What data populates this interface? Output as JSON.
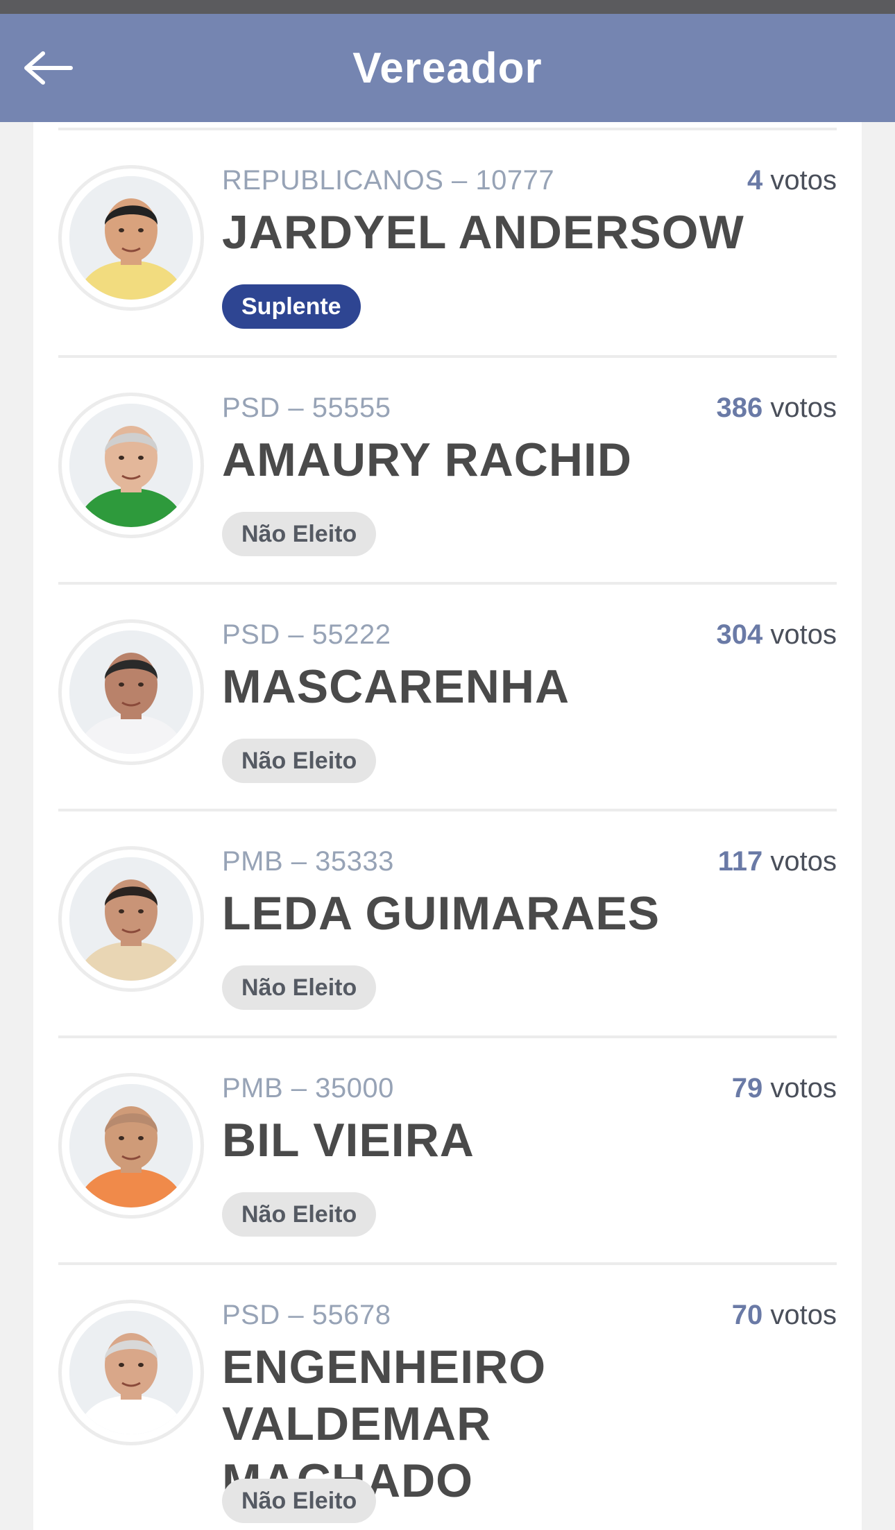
{
  "header": {
    "title": "Vereador",
    "back_icon": "arrow-left-icon"
  },
  "candidates": [
    {
      "party": "REPUBLICANOS – 10777",
      "votes_num": "4",
      "votes_unit": "votos",
      "name": "JARDYEL ANDERSOW",
      "status": "Suplente",
      "status_type": "suplente",
      "shirt_color": "#f2dc7f",
      "hair_color": "#222222",
      "skin_color": "#d9a27d"
    },
    {
      "party": "PSD – 55555",
      "votes_num": "386",
      "votes_unit": "votos",
      "name": "AMAURY RACHID",
      "status": "Não Eleito",
      "status_type": "nao-eleito",
      "shirt_color": "#2e9a3c",
      "hair_color": "#cfcfcf",
      "skin_color": "#e3b79a"
    },
    {
      "party": "PSD – 55222",
      "votes_num": "304",
      "votes_unit": "votos",
      "name": "MASCARENHA",
      "status": "Não Eleito",
      "status_type": "nao-eleito",
      "shirt_color": "#f4f4f6",
      "hair_color": "#2a2a2a",
      "skin_color": "#b9826a"
    },
    {
      "party": "PMB – 35333",
      "votes_num": "117",
      "votes_unit": "votos",
      "name": "LEDA GUIMARAES",
      "status": "Não Eleito",
      "status_type": "nao-eleito",
      "shirt_color": "#e9d6b4",
      "hair_color": "#2a2320",
      "skin_color": "#c99477"
    },
    {
      "party": "PMB – 35000",
      "votes_num": "79",
      "votes_unit": "votos",
      "name": "BIL VIEIRA",
      "status": "Não Eleito",
      "status_type": "nao-eleito",
      "shirt_color": "#f08a4a",
      "hair_color": "#b78a6e",
      "skin_color": "#cf9b78"
    },
    {
      "party": "PSD – 55678",
      "votes_num": "70",
      "votes_unit": "votos",
      "name": "ENGENHEIRO VALDEMAR MACHADO",
      "status": "Não Eleito",
      "status_type": "nao-eleito",
      "shirt_color": "#ffffff",
      "hair_color": "#d8d8d8",
      "skin_color": "#d9a789"
    }
  ]
}
